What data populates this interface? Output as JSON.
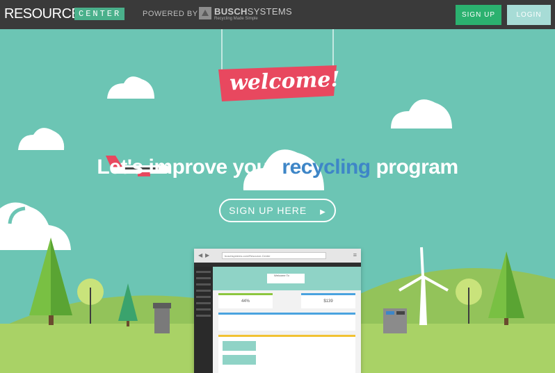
{
  "nav": {
    "logo_primary": "RESOURCE",
    "logo_secondary": "CENTER",
    "powered_by": "POWERED BY",
    "partner_name_bold": "BUSCH",
    "partner_name_light": "SYSTEMS",
    "partner_tagline": "Recycling Made Simple",
    "signup_label": "SIGN UP",
    "login_label": "LOGIN"
  },
  "hero": {
    "welcome_banner": "welcome!",
    "headline_part1": "Let's improve your ",
    "headline_accent": "recycling",
    "headline_part2": " program",
    "cta_label": "SIGN UP HERE",
    "cta_icon": "caret-right-icon"
  },
  "preview": {
    "url": "buschsystems.com/Resource-Center",
    "welcome": "Welcome To",
    "stat_left": "44%",
    "stat_right": "$139"
  },
  "colors": {
    "sky": "#6cc5b4",
    "topbar": "#3a3a3a",
    "signup_green": "#2bb16f",
    "login_teal": "#a7dcd6",
    "banner_red": "#e8485f",
    "accent_blue": "#3e86c7",
    "grass": "#a9d266",
    "hill": "#93c35a"
  }
}
